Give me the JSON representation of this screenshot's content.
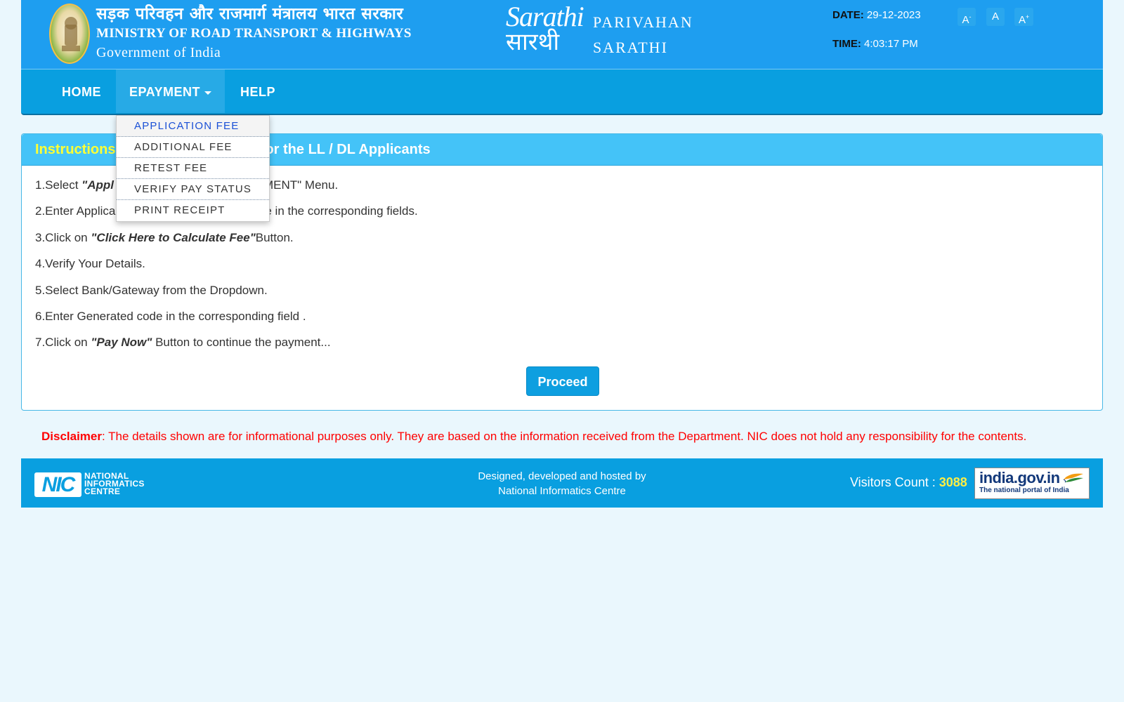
{
  "header": {
    "ministry_hindi": "सड़क परिवहन और राजमार्ग मंत्रालय भारत सरकार",
    "ministry_english": "MINISTRY OF ROAD TRANSPORT & HIGHWAYS",
    "government": "Government of India",
    "emblem_icon": "national-emblem-icon",
    "logo_text_top": "Sarathi",
    "logo_text_bottom": "सारथी",
    "portal_line1": "PARIVAHAN",
    "portal_line2": "SARATHI",
    "date_label": "DATE:",
    "date_value": "29-12-2023",
    "time_label": "TIME:",
    "time_value": "4:03:17 PM",
    "font_controls": [
      "A",
      "A",
      "A"
    ],
    "font_control_marks": [
      "-",
      "",
      "+"
    ]
  },
  "nav": {
    "home": "HOME",
    "epayment": "EPAYMENT",
    "help": "HELP",
    "dropdown": [
      "APPLICATION FEE",
      "ADDITIONAL FEE",
      "RETEST FEE",
      "VERIFY PAY STATUS",
      "PRINT RECEIPT"
    ]
  },
  "panel": {
    "title_highlight": "Instructions",
    "title_rest": "or the LL / DL Applicants",
    "steps": {
      "s1_pre": "1.Select ",
      "s1_bold": "\"Appl",
      "s1_post": "MENT\" Menu.",
      "s2_pre": "2.Enter Applica",
      "s2_post": "e in the corresponding fields.",
      "s3_pre": "3.Click on ",
      "s3_bold": "\"Click Here to Calculate Fee\"",
      "s3_post": "Button.",
      "s4": "4.Verify Your Details.",
      "s5": "5.Select Bank/Gateway from the Dropdown.",
      "s6": "6.Enter Generated code in the corresponding field .",
      "s7_pre": "7.Click on ",
      "s7_bold": "\"Pay Now\"",
      "s7_post": " Button to continue the payment..."
    },
    "proceed_label": "Proceed"
  },
  "disclaimer": {
    "label": "Disclaimer",
    "text": ": The details shown are for informational purposes only. They are based on the information received from the Department. NIC does not hold any responsibility for the contents."
  },
  "footer": {
    "nic_short": "NIC",
    "nic_line1": "NATIONAL",
    "nic_line2": "INFORMATICS",
    "nic_line3": "CENTRE",
    "credits_line1": "Designed, developed and hosted by",
    "credits_line2": "National Informatics Centre",
    "visitors_label": "Visitors Count : ",
    "visitors_count": "3088",
    "indiagov_title": "india.gov.in",
    "indiagov_sub": "The national portal of India"
  },
  "colors": {
    "header_bg": "#1e9ef0",
    "nav_bg": "#099fe0",
    "panel_head_bg": "#44c3f8",
    "highlight_yellow": "#ffff33",
    "disclaimer_red": "#ff0000",
    "dropdown_highlight": "#1a50d6"
  }
}
